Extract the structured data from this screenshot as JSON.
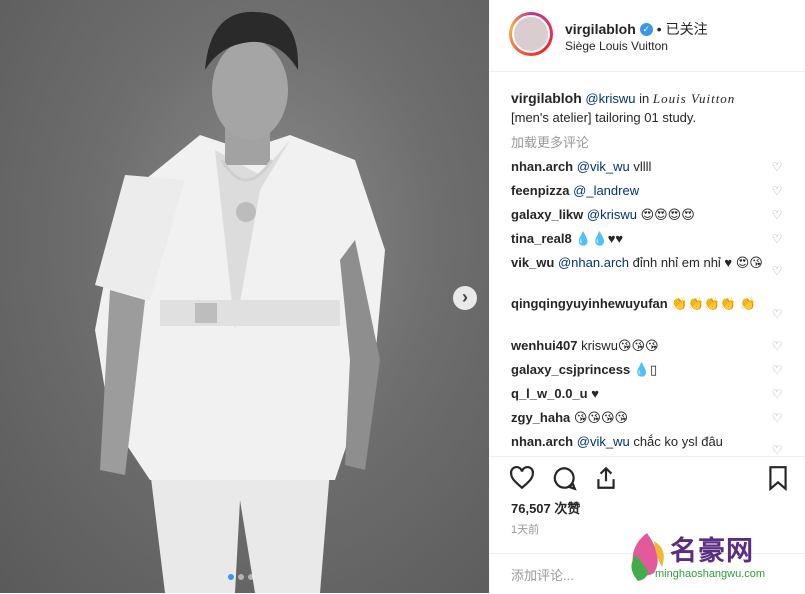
{
  "post": {
    "photo_label": "",
    "dots_active": 0,
    "dots_count": 3
  },
  "header": {
    "username": "virgilabloh",
    "follow_status": "• 已关注",
    "location": "Siège Louis Vuitton"
  },
  "caption": {
    "username": "virgilabloh",
    "mention": "@kriswu",
    "in_text": "in",
    "brand": "Louis Vuitton",
    "text": "[men's atelier] tailoring 01 study."
  },
  "load_more": "加载更多评论",
  "comments": [
    {
      "user": "nhan.arch",
      "mention": "@vik_wu",
      "text": "vllll"
    },
    {
      "user": "feenpizza",
      "mention": "@_landrew",
      "text": ""
    },
    {
      "user": "galaxy_likw",
      "mention": "@kriswu",
      "text": "😍😍😍😍"
    },
    {
      "user": "tina_real8",
      "mention": "",
      "text": "💧💧♥♥"
    },
    {
      "user": "vik_wu",
      "mention": "@nhan.arch",
      "text": "đỉnh nhỉ em nhỉ ♥ 😍😘"
    },
    {
      "user": "qingqingyuyinhewuyufan",
      "mention": "",
      "text": "👏👏👏👏 👏"
    },
    {
      "user": "wenhui407",
      "mention": "",
      "text": "kriswu😘😘😘"
    },
    {
      "user": "galaxy_csjprincess",
      "mention": "",
      "text": "💧▯"
    },
    {
      "user": "q_l_w_0.0_u",
      "mention": "",
      "text": "♥"
    },
    {
      "user": "zgy_haha",
      "mention": "",
      "text": "😘😘😘😘"
    },
    {
      "user": "nhan.arch",
      "mention": "@vik_wu",
      "text": "chắc ko ysl đâu"
    }
  ],
  "likes": "76,507 次赞",
  "time": "1天前",
  "add_comment_placeholder": "添加评论...",
  "watermark": {
    "name": "名豪网",
    "url": "minghaoshangwu.com"
  },
  "colors": {
    "verified": "#3897f0",
    "mention": "#003569",
    "muted": "#999999"
  }
}
